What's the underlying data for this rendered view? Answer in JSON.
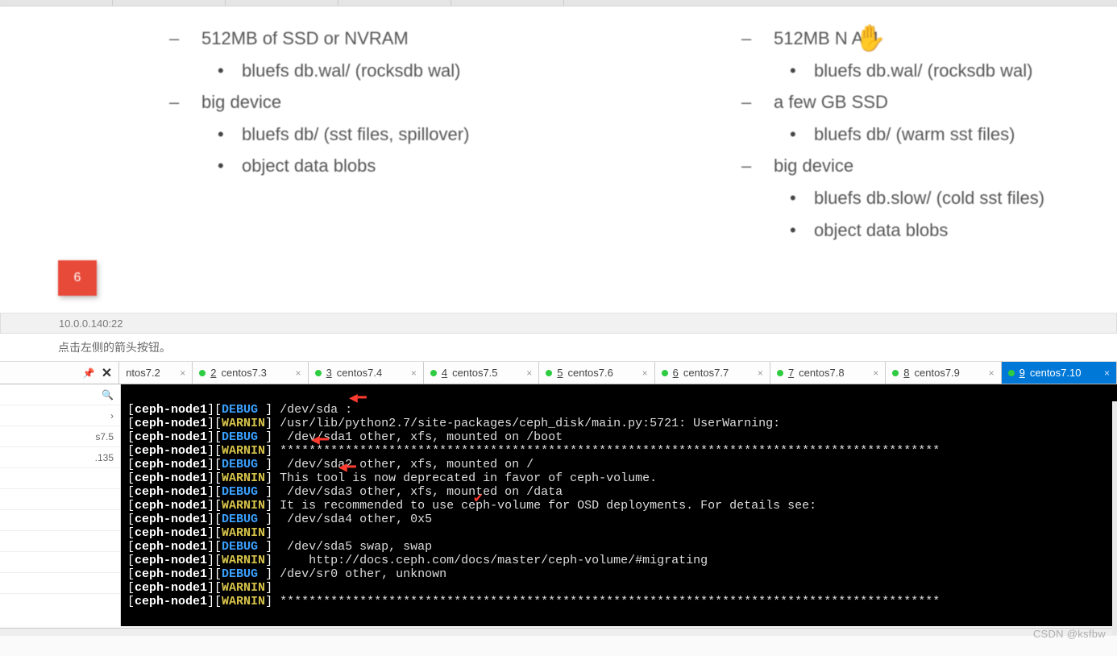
{
  "slide": {
    "left": {
      "l1": "512MB of SSD or NVRAM",
      "l2": "bluefs db.wal/ (rocksdb wal)",
      "l3": "big device",
      "l4": "bluefs db/ (sst files, spillover)",
      "l5": "object data blobs"
    },
    "right": {
      "r1": "512MB N     AM",
      "r2": "bluefs db.wal/ (rocksdb wal)",
      "r3": "a few GB SSD",
      "r4": "bluefs db/ (warm sst files)",
      "r5": "big device",
      "r6": "bluefs db.slow/ (cold sst files)",
      "r7": "object data blobs"
    },
    "badge": "6"
  },
  "conn": {
    "addr": "10.0.0.140:22"
  },
  "help": {
    "text": "点击左侧的箭头按钮。"
  },
  "tabs": {
    "t0": "ntos7.2",
    "t1_num": "2",
    "t1": " centos7.3",
    "t2_num": "3",
    "t2": " centos7.4",
    "t3_num": "4",
    "t3": " centos7.5",
    "t4_num": "5",
    "t4": " centos7.6",
    "t5_num": "6",
    "t5": " centos7.7",
    "t6_num": "7",
    "t6": " centos7.8",
    "t7_num": "8",
    "t7": " centos7.9",
    "t8_num": "9",
    "t8": " centos7.10"
  },
  "sidebar": {
    "row1": "s7.5",
    "row2": ".135"
  },
  "term": {
    "node": "ceph-node1",
    "levels": {
      "debug": "DEBUG",
      "warn": "WARNIN"
    },
    "l01": "/dev/sda :",
    "l02": "/usr/lib/python2.7/site-packages/ceph_disk/main.py:5721: UserWarning:",
    "l03": " /dev/sda1 other, xfs, mounted on /boot",
    "l04": "*******************************************************************************************",
    "l05": " /dev/sda2 other, xfs, mounted on /",
    "l06": "This tool is now deprecated in favor of ceph-volume.",
    "l07": " /dev/sda3 other, xfs, mounted on /data",
    "l08": "It is recommended to use ceph-volume for OSD deployments. For details see:",
    "l09": " /dev/sda4 other, 0x5",
    "l10": "",
    "l11": " /dev/sda5 swap, swap",
    "l12": "    http://docs.ceph.com/docs/master/ceph-volume/#migrating",
    "l13": "/dev/sr0 other, unknown",
    "l14": "",
    "l15": "*******************************************************************************************"
  },
  "watermark": "CSDN @ksfbw"
}
